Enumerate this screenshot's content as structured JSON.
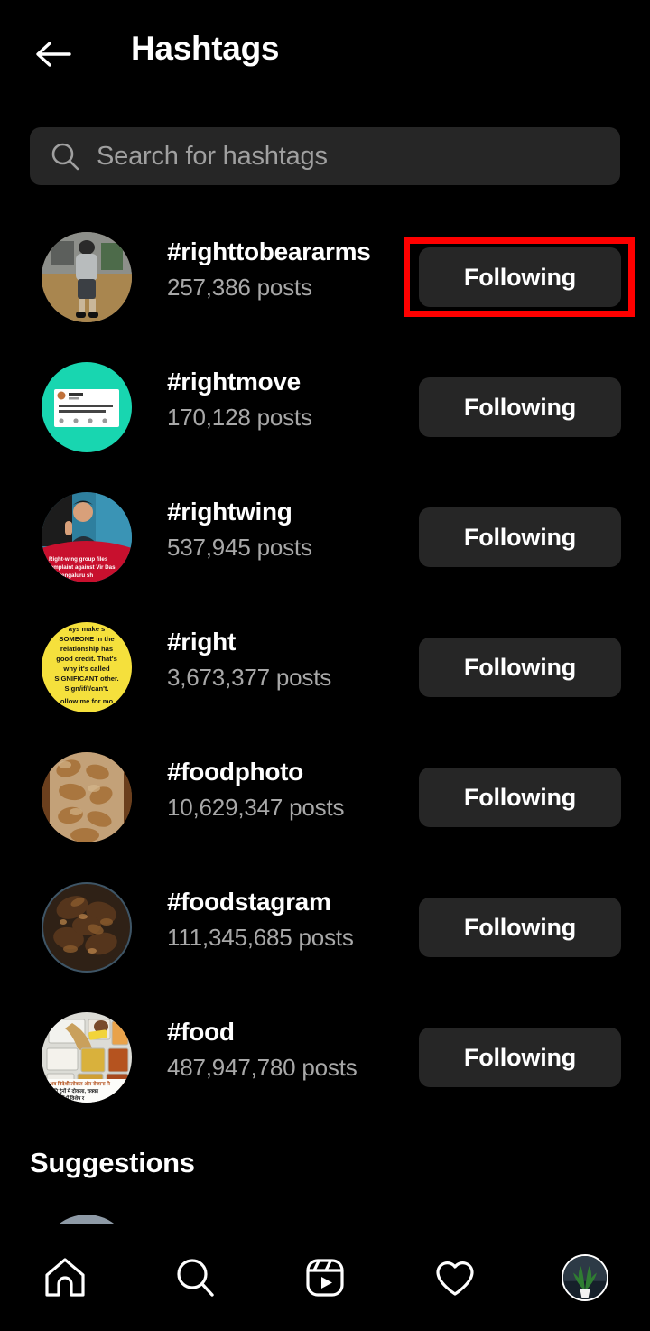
{
  "header": {
    "title": "Hashtags",
    "back_icon": "arrow-left-icon"
  },
  "search": {
    "placeholder": "Search for hashtags",
    "value": "",
    "icon": "search-icon"
  },
  "list": {
    "rows": [
      {
        "tag": "#righttobeararms",
        "count": "257,386 posts",
        "button": "Following",
        "highlighted": true
      },
      {
        "tag": "#rightmove",
        "count": "170,128 posts",
        "button": "Following",
        "highlighted": false
      },
      {
        "tag": "#rightwing",
        "count": "537,945 posts",
        "button": "Following",
        "highlighted": false
      },
      {
        "tag": "#right",
        "count": "3,673,377 posts",
        "button": "Following",
        "highlighted": false
      },
      {
        "tag": "#foodphoto",
        "count": "10,629,347 posts",
        "button": "Following",
        "highlighted": false
      },
      {
        "tag": "#foodstagram",
        "count": "111,345,685 posts",
        "button": "Following",
        "highlighted": false
      },
      {
        "tag": "#food",
        "count": "487,947,780 posts",
        "button": "Following",
        "highlighted": false
      }
    ]
  },
  "suggestions": {
    "title": "Suggestions"
  },
  "navbar": {
    "items": [
      {
        "icon": "home-icon",
        "active": false
      },
      {
        "icon": "search-icon",
        "active": false
      },
      {
        "icon": "reels-icon",
        "active": false
      },
      {
        "icon": "heart-icon",
        "active": false
      },
      {
        "icon": "profile-avatar-icon",
        "active": true
      }
    ]
  },
  "colors": {
    "background": "#000000",
    "surface": "#262626",
    "text_primary": "#ffffff",
    "text_secondary": "#a8a8a8",
    "highlight": "#ff0000"
  }
}
